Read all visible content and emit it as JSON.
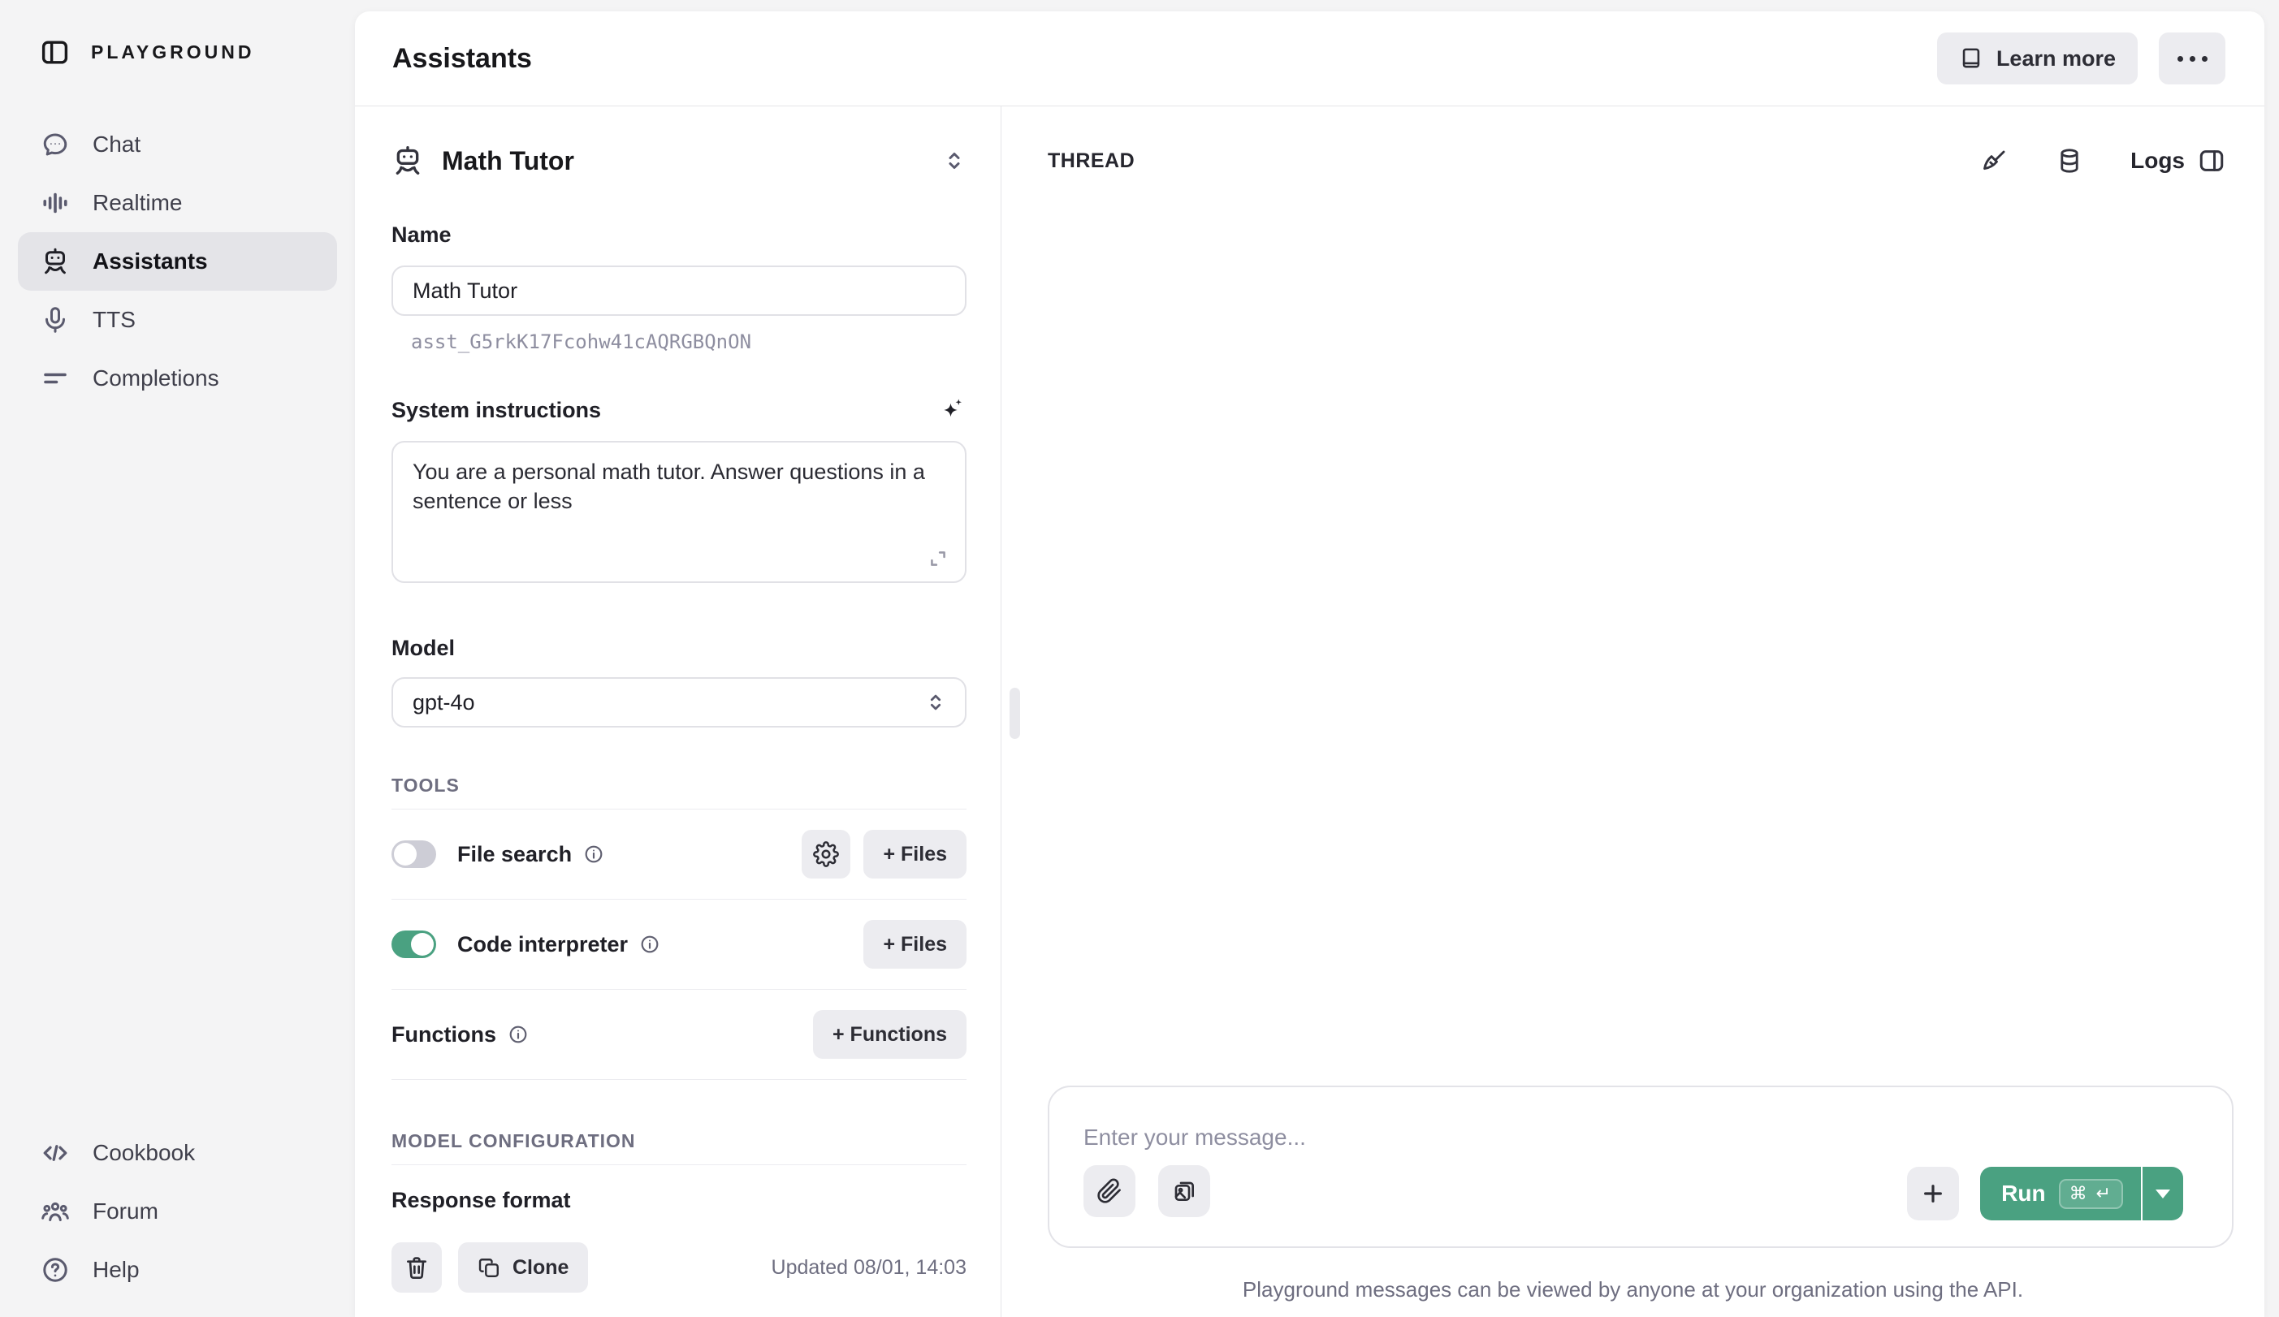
{
  "colors": {
    "accent_green": "#4aa181",
    "page_background": "#f4f4f5",
    "card_background": "#ffffff",
    "active_item_background": "#e4e4e8",
    "button_gray": "#ececf0",
    "muted_text": "#6e6e80",
    "border": "#e3e3e8"
  },
  "sidebar": {
    "logo": "PLAYGROUND",
    "items": [
      {
        "label": "Chat",
        "icon": "chat-bubble-icon",
        "active": false
      },
      {
        "label": "Realtime",
        "icon": "waveform-icon",
        "active": false
      },
      {
        "label": "Assistants",
        "icon": "robot-icon",
        "active": true
      },
      {
        "label": "TTS",
        "icon": "microphone-icon",
        "active": false
      },
      {
        "label": "Completions",
        "icon": "lines-icon",
        "active": false
      }
    ],
    "footer_items": [
      {
        "label": "Cookbook",
        "icon": "code-icon"
      },
      {
        "label": "Forum",
        "icon": "people-icon"
      },
      {
        "label": "Help",
        "icon": "question-circle-icon"
      }
    ]
  },
  "header": {
    "title": "Assistants",
    "learn_more_label": "Learn more"
  },
  "config": {
    "assistant_name": "Math Tutor",
    "name_label": "Name",
    "name_value": "Math Tutor",
    "assistant_id": "asst_G5rkK17Fcohw41cAQRGBQnON",
    "system_instructions_label": "System instructions",
    "system_instructions_value": "You are a personal math tutor. Answer questions in a sentence or less",
    "model_label": "Model",
    "model_value": "gpt-4o",
    "tools_header": "TOOLS",
    "tools": [
      {
        "label": "File search",
        "enabled": false,
        "action_label": "+ Files",
        "has_settings": true
      },
      {
        "label": "Code interpreter",
        "enabled": true,
        "action_label": "+ Files",
        "has_settings": false
      }
    ],
    "functions_label": "Functions",
    "functions_action_label": "+ Functions",
    "model_config_header": "MODEL CONFIGURATION",
    "response_format_label": "Response format",
    "clone_label": "Clone",
    "updated_text": "Updated 08/01, 14:03"
  },
  "thread": {
    "header": "THREAD",
    "logs_label": "Logs",
    "input_placeholder": "Enter your message...",
    "run_label": "Run",
    "run_kbd": "⌘ ↵",
    "footer_note": "Playground messages can be viewed by anyone at your organization using the API."
  }
}
